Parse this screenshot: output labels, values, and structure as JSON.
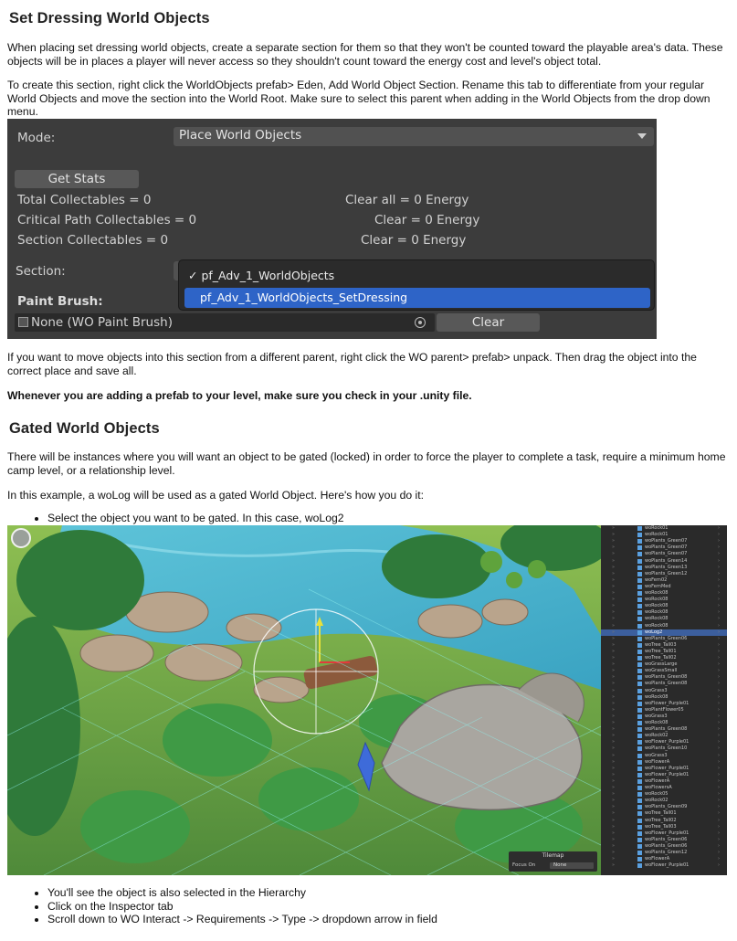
{
  "section1": {
    "heading": "Set Dressing World Objects",
    "para1": "When placing set dressing world objects, create a separate section for them so that they won't be counted toward the playable area's data. These objects will be in places a player will never access so they shouldn't count toward the energy cost and level's object total.",
    "para2": "To create this section, right click the WorldObjects prefab> Eden, Add World Object Section. Rename this tab to differentiate from your regular World Objects and move the section into the World Root. Make sure to select this parent when adding in the World Objects from the drop down menu."
  },
  "unity_panel": {
    "mode_label": "Mode:",
    "mode_value": "Place World Objects",
    "get_stats_button": "Get Stats",
    "stats": [
      {
        "label": "Total Collectables = 0",
        "energy": "Clear all = 0 Energy"
      },
      {
        "label": "Critical Path Collectables = 0",
        "energy": "Clear = 0 Energy"
      },
      {
        "label": "Section Collectables = 0",
        "energy": "Clear = 0 Energy"
      }
    ],
    "section_label": "Section:",
    "dropdown_options": [
      {
        "label": "✓ pf_Adv_1_WorldObjects",
        "selected": false
      },
      {
        "label": "pf_Adv_1_WorldObjects_SetDressing",
        "highlighted": true
      }
    ],
    "paint_brush_label": "Paint Brush:",
    "paint_brush_value": "None (WO Paint Brush)",
    "clear_button": "Clear"
  },
  "after_panel": {
    "para3": "If you want to move objects into this section from a different parent, right click the WO parent> prefab> unpack. Then drag the object into the correct place and save all.",
    "para4_bold": "Whenever you are adding a prefab to your level, make sure you check in your .unity file."
  },
  "section2": {
    "heading": "Gated World Objects",
    "para1": "There will be instances where you will want an object to be gated (locked) in order to force the player to complete a task, require a minimum home camp level, or a relationship level.",
    "para2": "In this example, a woLog will be used as a gated World Object. Here's how you do it:",
    "bullet1": "Select the object you want to be gated. In this case, woLog2",
    "bullets_after": [
      "You'll see the object is also selected in the Hierarchy",
      "Click on the Inspector tab",
      "Scroll down to WO Interact -> Requirements -> Type -> dropdown arrow in field"
    ]
  },
  "scene": {
    "hierarchy_items": [
      "woRock01",
      "woRock01",
      "woPlants_Green07",
      "woPlants_Green07",
      "woPlants_Green07",
      "woPlants_Green14",
      "woPlants_Green13",
      "woPlants_Green12",
      "woFern02",
      "woFernMed",
      "woRock08",
      "woRock08",
      "woRock08",
      "woRock08",
      "woRock08",
      "woRock08",
      "woLog2",
      "woPlants_Green06",
      "woTree_Tall03",
      "woTree_Tall01",
      "woTree_Tall02",
      "woGrassLarge",
      "woGrassSmall",
      "woPlants_Green08",
      "woPlants_Green08",
      "woGrass3",
      "woRock08",
      "woFlower_Purple01",
      "woPlantFlower05",
      "woGrass3",
      "woRock08",
      "woPlants_Green08",
      "woRock02",
      "woFlower_Purple01",
      "woPlants_Green10",
      "woGrass3",
      "woFlowerA",
      "woFlower_Purple01",
      "woFlower_Purple01",
      "woFlowerA",
      "woFlowersA",
      "woRock05",
      "woRock02",
      "woPlants_Green09",
      "woTree_Tall01",
      "woTree_Tall02",
      "woTree_Tall03",
      "woFlower_Purple01",
      "woPlants_Green06",
      "woPlants_Green06",
      "woPlants_Green12",
      "woFlowerA",
      "woFlower_Purple01"
    ],
    "selected_index": 16,
    "tilemap_title": "Tilemap",
    "focus_label": "Focus On",
    "focus_value": "None"
  }
}
